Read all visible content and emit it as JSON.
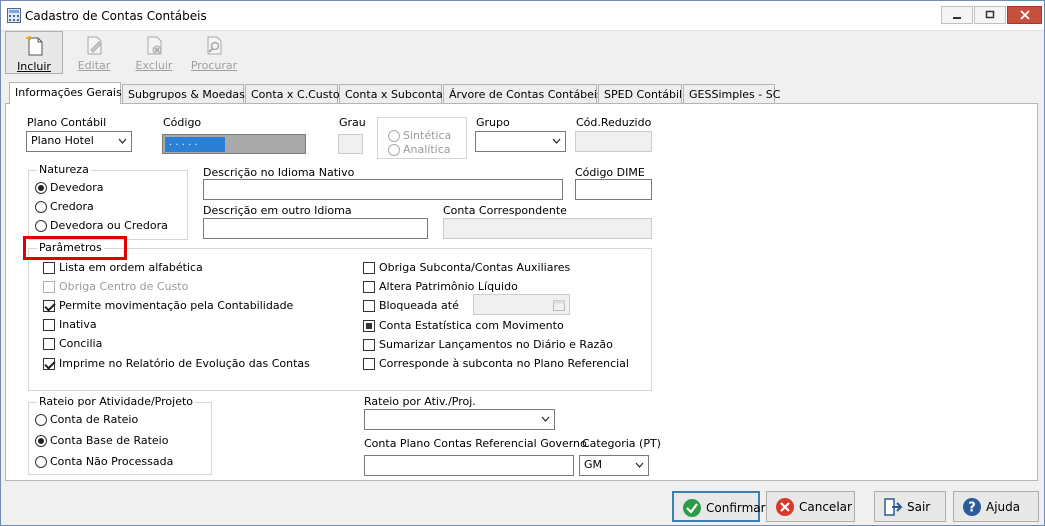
{
  "window": {
    "title": "Cadastro de Contas Contábeis"
  },
  "toolbar": {
    "incluir": "Incluir",
    "editar": "Editar",
    "excluir": "Excluir",
    "procurar": "Procurar"
  },
  "tabs": [
    {
      "label": "Informações Gerais"
    },
    {
      "label": "Subgrupos & Moedas"
    },
    {
      "label": "Conta x C.Custo"
    },
    {
      "label": "Conta x Subconta"
    },
    {
      "label": "Árvore de Contas Contábeis"
    },
    {
      "label": "SPED Contábil"
    },
    {
      "label": "GESSimples - SC"
    }
  ],
  "form": {
    "plano_contabil_label": "Plano Contábil",
    "plano_contabil_value": "Plano Hotel",
    "codigo_label": "Código",
    "codigo_value": ". . . . .",
    "grau_label": "Grau",
    "sintetica": "Sintética",
    "analitica": "Analítica",
    "grupo_label": "Grupo",
    "cod_reduzido_label": "Cód.Reduzido",
    "natureza_title": "Natureza",
    "natureza_options": [
      "Devedora",
      "Credora",
      "Devedora ou Credora"
    ],
    "descricao_nativo_label": "Descrição no Idioma Nativo",
    "codigo_dime_label": "Código DIME",
    "descricao_outro_label": "Descrição em outro Idioma",
    "conta_correspondente_label": "Conta Correspondente",
    "parametros_title": "Parâmetros",
    "param_left": [
      "Lista em ordem alfabética",
      "Obriga Centro de Custo",
      "Permite movimentação pela Contabilidade",
      "Inativa",
      "Concilia",
      "Imprime no Relatório de Evolução das Contas"
    ],
    "param_right": [
      "Obriga Subconta/Contas Auxiliares",
      "Altera Patrimônio Líquido",
      "Bloqueada até",
      "Conta Estatística com Movimento",
      "Sumarizar Lançamentos no Diário e Razão",
      "Corresponde à subconta no Plano Referencial"
    ],
    "rateio_title": "Rateio por Atividade/Projeto",
    "rateio_options": [
      "Conta de Rateio",
      "Conta Base de Rateio",
      "Conta Não Processada"
    ],
    "rateio_ativ_label": "Rateio por Ativ./Proj.",
    "conta_ref_gov_label": "Conta Plano Contas Referencial Governo",
    "categoria_label": "Categoria (PT)",
    "categoria_value": "GM"
  },
  "buttons": {
    "confirmar": "Confirmar",
    "cancelar": "Cancelar",
    "sair": "Sair",
    "ajuda": "Ajuda"
  },
  "colors": {
    "highlight": "#e00000",
    "selection": "#2d7fd6",
    "close": "#c7503d"
  }
}
